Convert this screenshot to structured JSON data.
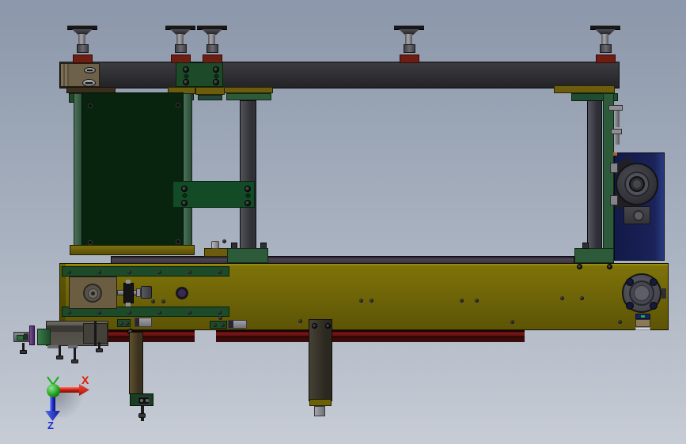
{
  "viewport": {
    "type": "cad-3d-viewport",
    "scene": "side view of a conveyor machine assembly shown inverted on leveling feet"
  },
  "triad": {
    "x_label": "X",
    "z_label": "Z"
  },
  "palette": {
    "bg-top": "#8b97aa",
    "bg-bottom": "#c7ccd5",
    "beam-dark": "#2e2e33",
    "frame-yellow": "#6e6407",
    "panel-green": "#08240f",
    "plate-green": "#1d4a28",
    "block-green": "#2d5b3a",
    "rail-green": "#3c6248",
    "metal-gray": "#8f8f94",
    "steel-dark": "#46464c",
    "maroon": "#5c1111",
    "foot-red": "#6e1d12",
    "motor-navy": "#141c4e",
    "bronze-brown": "#6e6149",
    "plate-brown": "#6a5d42",
    "olive": "#6b5c0e",
    "guide-purple": "#453e4d",
    "clamp-purple": "#5a3070",
    "axis-x": "#e01800",
    "axis-y": "#14b014",
    "axis-z": "#1a2fd0"
  }
}
